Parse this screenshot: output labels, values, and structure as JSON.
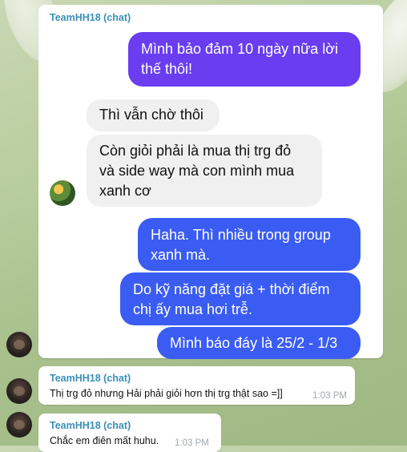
{
  "message_image": {
    "sender": "TeamHH18 (chat)",
    "bubbles": [
      {
        "lines": [
          "Mình bảo đảm 10 ngày nữa lời",
          "thế thôi!"
        ]
      },
      {
        "lines": [
          "Thì vẫn chờ thôi"
        ]
      },
      {
        "lines": [
          "Còn giỏi phải là mua thị trg đỏ",
          "và side way mà con mình mua",
          "xanh cơ"
        ]
      },
      {
        "lines": [
          "Haha. Thì nhiều trong group",
          "xanh mà."
        ]
      },
      {
        "lines": [
          "Do kỹ năng đặt giá + thời điểm",
          "chị ấy mua hơi trễ."
        ]
      },
      {
        "lines": [
          "Mình báo đáy là 25/2 - 1/3"
        ]
      }
    ]
  },
  "message_2": {
    "sender": "TeamHH18 (chat)",
    "text": "Thị trg đỏ nhưng Hải phải giỏi hơn thị trg thật sao =]]",
    "time": "1:03 PM"
  },
  "message_3": {
    "sender": "TeamHH18 (chat)",
    "text": "Chắc em điên mất huhu.",
    "time": "1:03 PM"
  },
  "colors": {
    "purple_bubble": "#6a3df0",
    "blue_bubble": "#3a5cf2",
    "sender_name": "#3a8fb7"
  }
}
